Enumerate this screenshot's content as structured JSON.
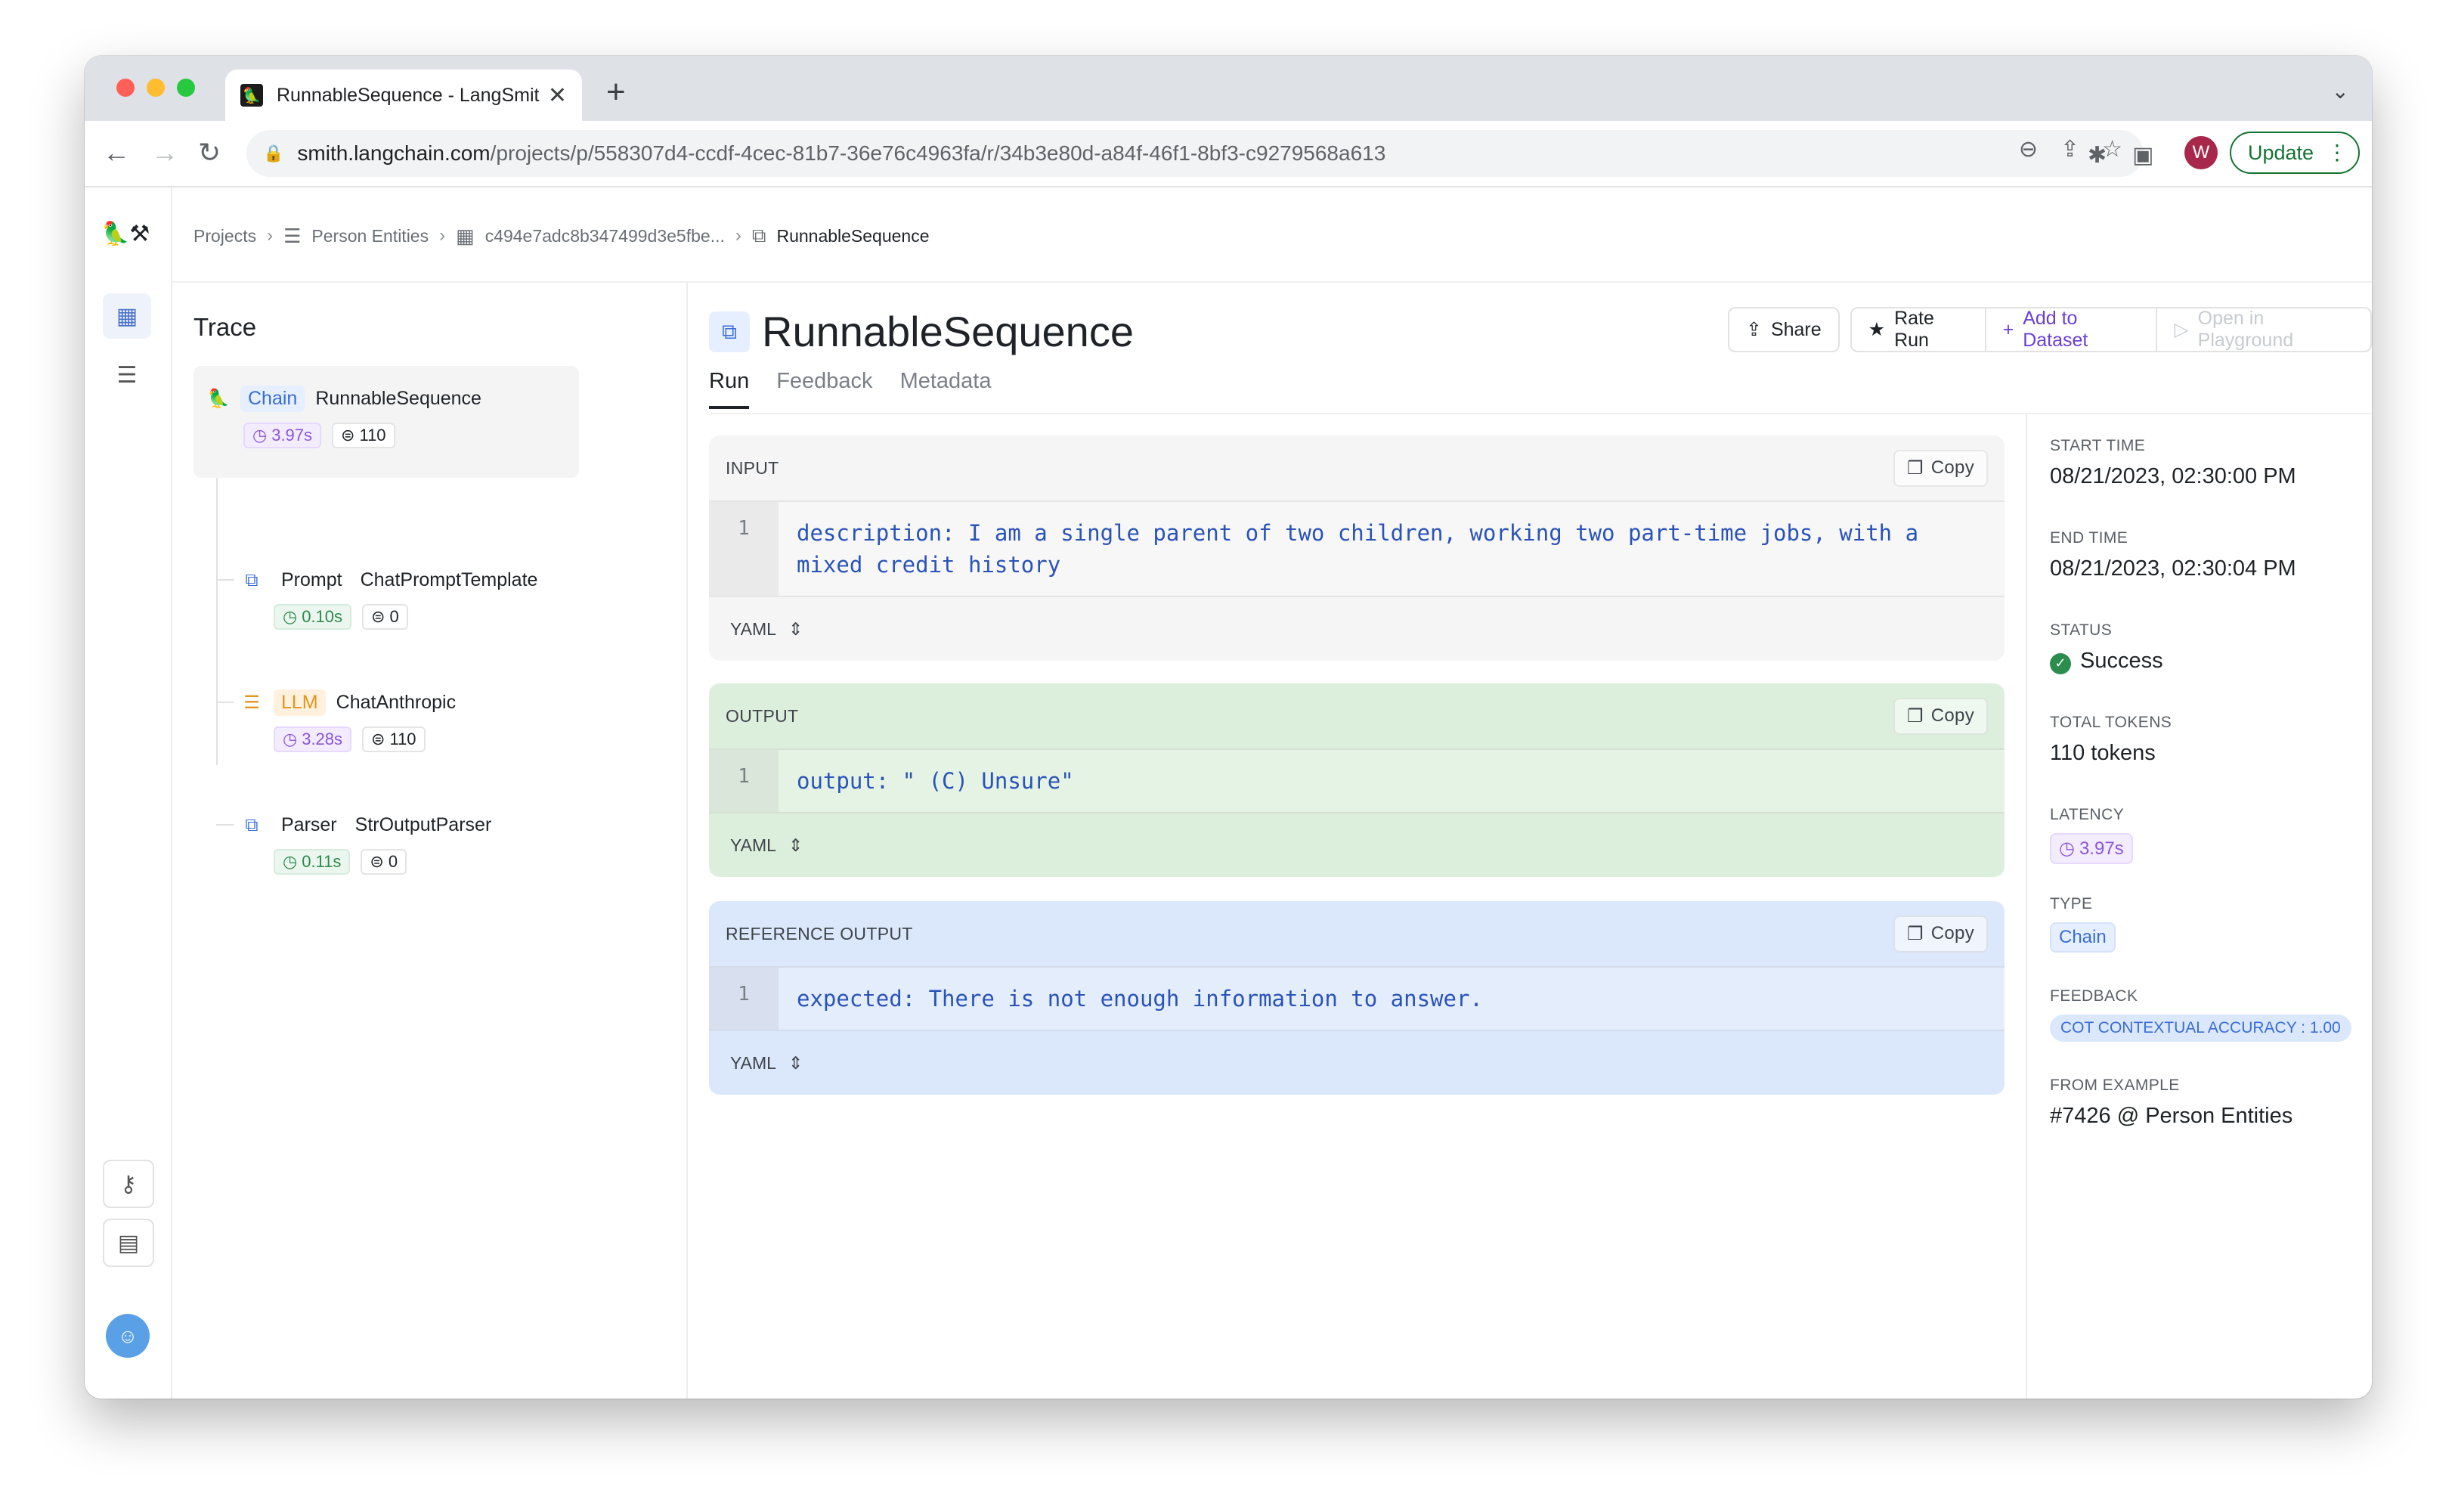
{
  "browser": {
    "tab_title": "RunnableSequence - LangSmith",
    "url_host": "smith.langchain.com",
    "url_path": "/projects/p/558307d4-ccdf-4cec-81b7-36e76c4963fa/r/34b3e80d-a84f-46f1-8bf3-c9279568a613",
    "avatar_letter": "W",
    "update_label": "Update"
  },
  "breadcrumb": {
    "projects": "Projects",
    "dataset": "Person Entities",
    "session": "c494e7adc8b347499d3e5fbe...",
    "current": "RunnableSequence"
  },
  "trace": {
    "title": "Trace",
    "root": {
      "kind": "Chain",
      "name": "RunnableSequence",
      "latency": "3.97s",
      "tokens": "110"
    },
    "children": [
      {
        "kind": "Prompt",
        "name": "ChatPromptTemplate",
        "latency": "0.10s",
        "tokens": "0"
      },
      {
        "kind": "LLM",
        "name": "ChatAnthropic",
        "latency": "3.28s",
        "tokens": "110"
      },
      {
        "kind": "Parser",
        "name": "StrOutputParser",
        "latency": "0.11s",
        "tokens": "0"
      }
    ]
  },
  "run": {
    "title": "RunnableSequence",
    "actions": {
      "share": "Share",
      "rate": "Rate Run",
      "add": "Add to Dataset",
      "playground": "Open in Playground"
    },
    "tabs": [
      "Run",
      "Feedback",
      "Metadata"
    ],
    "input": {
      "label": "INPUT",
      "copy": "Copy",
      "line_no": "1",
      "code": "description: I am a single parent of two children, working two part-time jobs, with a\nmixed credit history",
      "format": "YAML"
    },
    "output": {
      "label": "OUTPUT",
      "copy": "Copy",
      "line_no": "1",
      "code": "output: \" (C) Unsure\"",
      "format": "YAML"
    },
    "reference": {
      "label": "REFERENCE OUTPUT",
      "copy": "Copy",
      "line_no": "1",
      "code": "expected: There is not enough information to answer.",
      "format": "YAML"
    }
  },
  "details": {
    "start_label": "START TIME",
    "start_value": "08/21/2023, 02:30:00 PM",
    "end_label": "END TIME",
    "end_value": "08/21/2023, 02:30:04 PM",
    "status_label": "STATUS",
    "status_value": "Success",
    "tokens_label": "TOTAL TOKENS",
    "tokens_value": "110 tokens",
    "latency_label": "LATENCY",
    "latency_value": "3.97s",
    "type_label": "TYPE",
    "type_value": "Chain",
    "feedback_label": "FEEDBACK",
    "feedback_value": "COT CONTEXTUAL ACCURACY : 1.00",
    "example_label": "FROM EXAMPLE",
    "example_value": "#7426 @ Person Entities"
  }
}
